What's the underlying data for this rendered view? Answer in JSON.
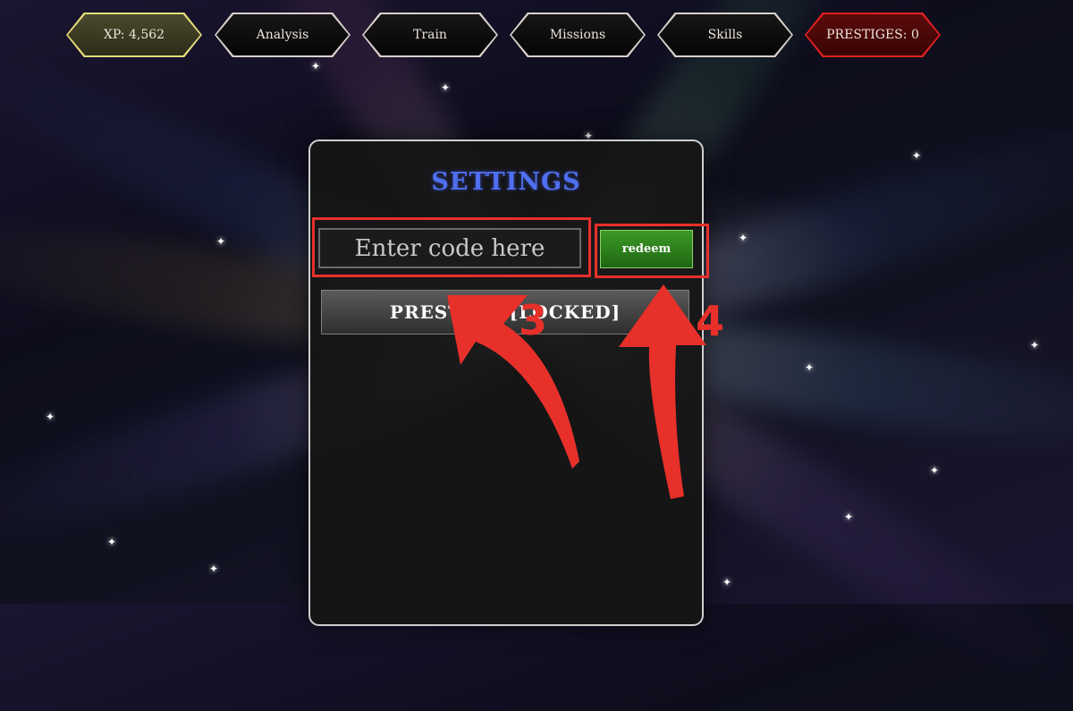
{
  "nav": {
    "xp": "XP: 4,562",
    "analysis": "Analysis",
    "train": "Train",
    "missions": "Missions",
    "skills": "Skills",
    "prestiges": "PRESTIGES: 0"
  },
  "settings": {
    "title": "SETTINGS",
    "code_placeholder": "Enter code here",
    "redeem_label": "redeem",
    "prestige_label": "PRESTIGE [LOCKED]"
  },
  "annotations": {
    "step_input": "3",
    "step_redeem": "4"
  },
  "colors": {
    "annotation_red": "#e8302a",
    "title_blue": "#4f6ff0",
    "redeem_green": "#2e8a1e",
    "xp_border": "#e3dc7a",
    "prestige_border": "#e02020"
  }
}
